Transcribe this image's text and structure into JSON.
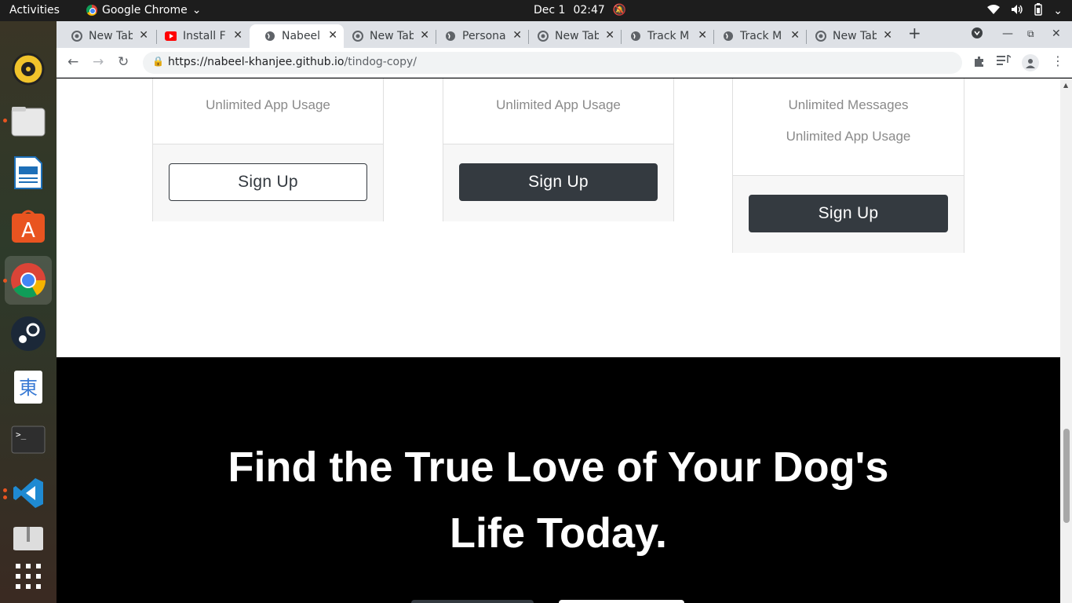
{
  "system": {
    "activities": "Activities",
    "app_name": "Google Chrome",
    "date": "Dec 1",
    "time": "02:47"
  },
  "tabs": [
    {
      "title": "New Tab",
      "icon": "chrome-icon"
    },
    {
      "title": "Install F",
      "icon": "youtube-icon"
    },
    {
      "title": "Nabeel",
      "icon": "globe-icon",
      "active": true
    },
    {
      "title": "New Tab",
      "icon": "chrome-icon"
    },
    {
      "title": "Persona",
      "icon": "globe-icon"
    },
    {
      "title": "New Tab",
      "icon": "chrome-icon"
    },
    {
      "title": "Track M",
      "icon": "globe-icon"
    },
    {
      "title": "Track M",
      "icon": "globe-icon"
    },
    {
      "title": "New Tab",
      "icon": "chrome-icon"
    }
  ],
  "address": {
    "host": "https://nabeel-khanjee.github.io",
    "path": "/tindog-copy/"
  },
  "pricing": {
    "card1": {
      "features": [
        "Unlimited App Usage"
      ],
      "button": "Sign Up"
    },
    "card2": {
      "features": [
        "Unlimited App Usage"
      ],
      "button": "Sign Up"
    },
    "card3": {
      "features": [
        "Unlimited Messages",
        "Unlimited App Usage"
      ],
      "button": "Sign Up"
    }
  },
  "cta": {
    "line1": "Find the True Love of Your Dog's",
    "line2": "Life Today."
  },
  "colors": {
    "dark_button": "#343a40",
    "cta_background": "#000000"
  }
}
